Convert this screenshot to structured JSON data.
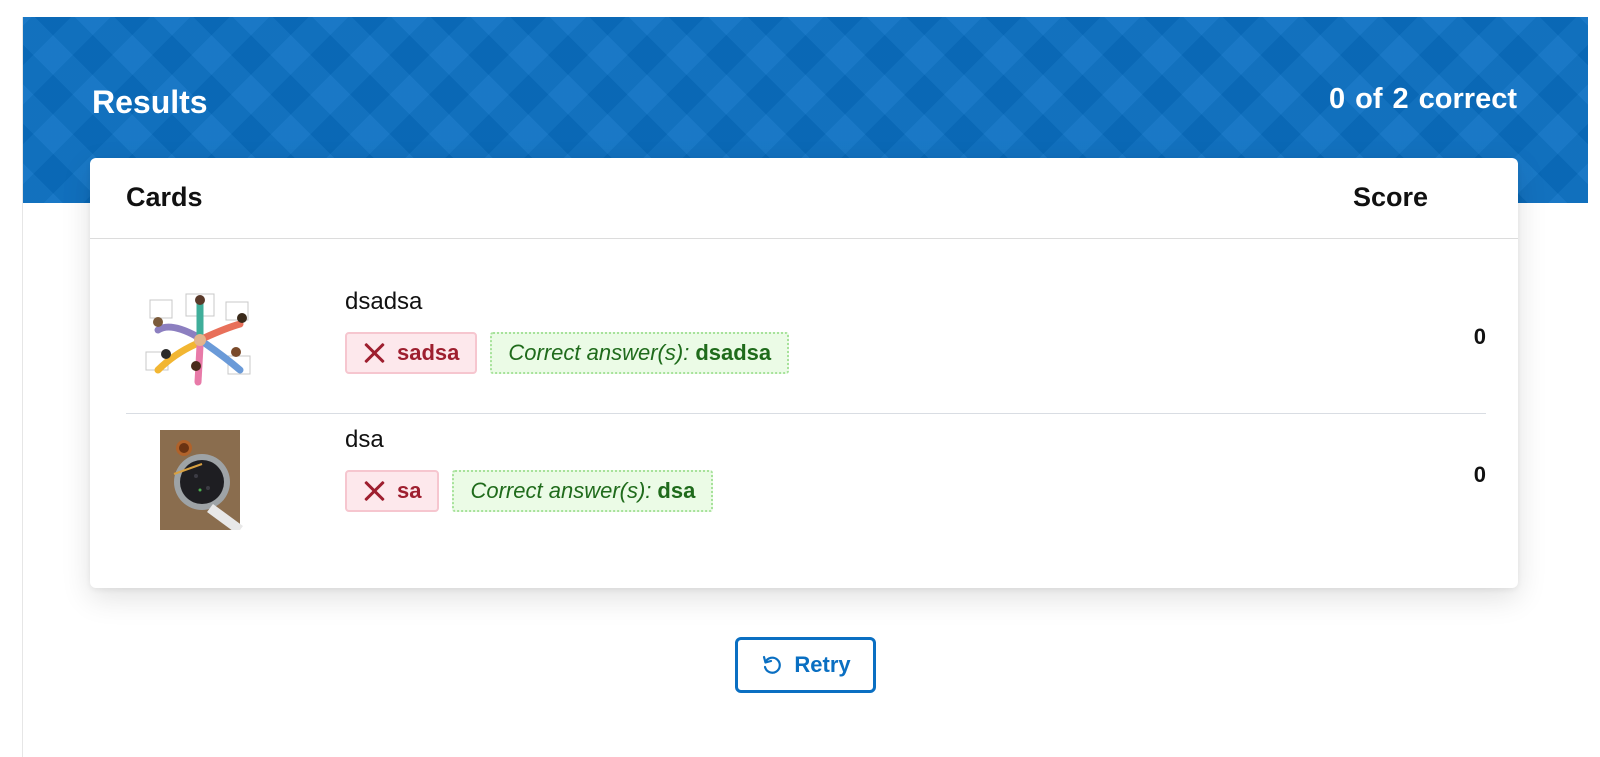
{
  "header": {
    "title": "Results",
    "score_value": "0",
    "score_of": "of",
    "score_total": "2",
    "score_word": "correct"
  },
  "table": {
    "col_cards": "Cards",
    "col_score": "Score",
    "rows": [
      {
        "image": "team-hands-illustration",
        "prompt": "dsadsa",
        "user_answer": "sadsa",
        "correct_label": "Correct answer(s):",
        "correct_value": "dsadsa",
        "score": "0"
      },
      {
        "image": "food-bowl-photo",
        "prompt": "dsa",
        "user_answer": "sa",
        "correct_label": "Correct answer(s):",
        "correct_value": "dsa",
        "score": "0"
      }
    ]
  },
  "retry_label": "Retry",
  "colors": {
    "accent": "#0a6fc2",
    "wrong_bg": "#fde8ec",
    "wrong_text": "#9e1f2f",
    "correct_bg": "#ebfbe6",
    "correct_text": "#1f6b1b"
  }
}
